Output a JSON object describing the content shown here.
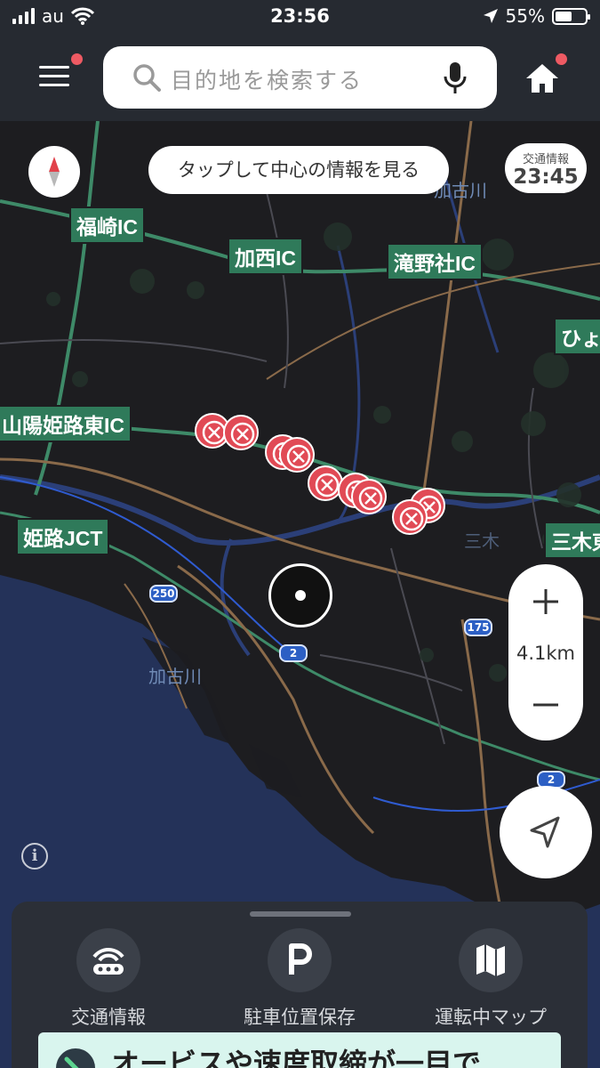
{
  "status_bar": {
    "carrier": "au",
    "time": "23:56",
    "battery": "55%",
    "battery_level": 0.55
  },
  "search": {
    "placeholder": "目的地を検索する"
  },
  "map": {
    "tap_center_hint": "タップして中心の情報を見る",
    "traffic_info": {
      "label": "交通情報",
      "time": "23:45"
    },
    "ic_labels": [
      "福崎IC",
      "加西IC",
      "滝野社IC",
      "ひょ",
      "山陽姫路東IC",
      "姫路JCT",
      "三木東"
    ],
    "place_labels": [
      "加古川",
      "加古川",
      "三木"
    ],
    "route_shields": [
      "250",
      "2",
      "175",
      "2"
    ],
    "scale": "4.1km",
    "incident_icon": "closure-icon"
  },
  "bottom_sheet": {
    "items": [
      {
        "label": "交通情報",
        "icon": "traffic-icon"
      },
      {
        "label": "駐車位置保存",
        "icon": "parking-icon"
      },
      {
        "label": "運転中マップ",
        "icon": "map-icon"
      }
    ],
    "promo_text": "オービスや速度取締が一目で"
  },
  "colors": {
    "map_land": "#1d1d20",
    "map_sea": "#243259",
    "expressway": "#3e8a68",
    "road": "#8a6a4a",
    "river": "#2b3f78",
    "ic_label_bg": "#2f7a5a",
    "incident": "#e14a55",
    "notification_dot": "#ee5a63"
  }
}
